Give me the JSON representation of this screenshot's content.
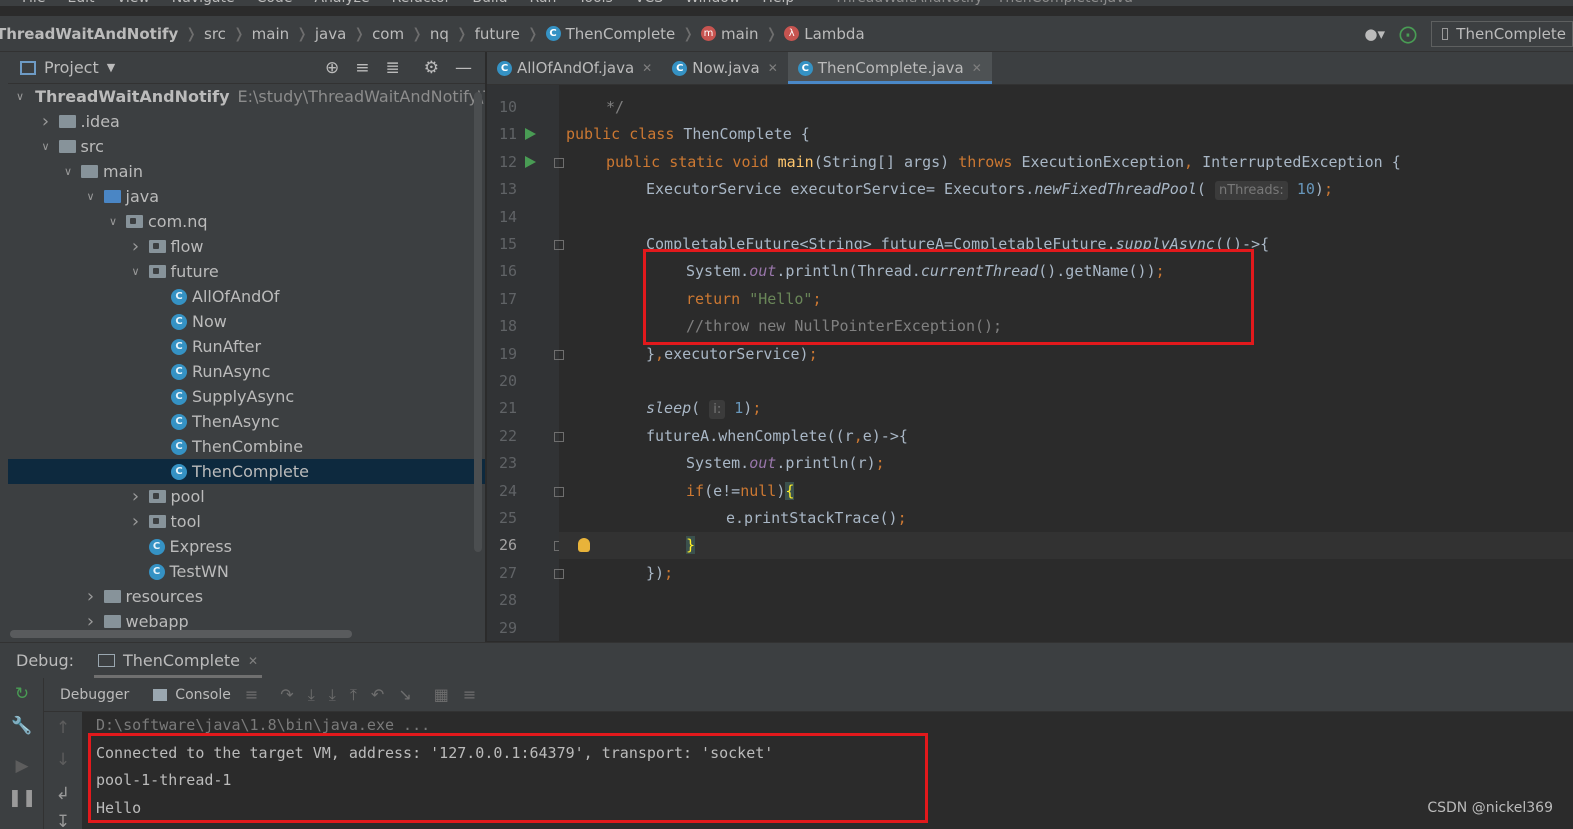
{
  "menu": {
    "items": [
      "File",
      "Edit",
      "View",
      "Navigate",
      "Code",
      "Analyze",
      "Refactor",
      "Build",
      "Run",
      "Tools",
      "VCS",
      "Window",
      "Help"
    ],
    "window_title": "ThreadWaitAndNotify - ThenComplete.java"
  },
  "breadcrumbs": [
    "ThreadWaitAndNotify",
    "src",
    "main",
    "java",
    "com",
    "nq",
    "future",
    "ThenComplete",
    "main",
    "Lambda"
  ],
  "nav_right": {
    "run_config": "ThenComplete"
  },
  "project_panel": {
    "title": "Project",
    "root": {
      "name": "ThreadWaitAndNotify",
      "path": "E:\\study\\ThreadWaitAndNotify\\Th"
    },
    "tree": [
      {
        "label": ".idea",
        "depth": 1,
        "expand": "collapsed",
        "kind": "folder"
      },
      {
        "label": "src",
        "depth": 1,
        "expand": "expanded",
        "kind": "folder"
      },
      {
        "label": "main",
        "depth": 2,
        "expand": "expanded",
        "kind": "folder"
      },
      {
        "label": "java",
        "depth": 3,
        "expand": "expanded",
        "kind": "folder-blue"
      },
      {
        "label": "com.nq",
        "depth": 4,
        "expand": "expanded",
        "kind": "package"
      },
      {
        "label": "flow",
        "depth": 5,
        "expand": "collapsed",
        "kind": "package"
      },
      {
        "label": "future",
        "depth": 5,
        "expand": "expanded",
        "kind": "package"
      },
      {
        "label": "AllOfAndOf",
        "depth": 6,
        "expand": "none",
        "kind": "class"
      },
      {
        "label": "Now",
        "depth": 6,
        "expand": "none",
        "kind": "class"
      },
      {
        "label": "RunAfter",
        "depth": 6,
        "expand": "none",
        "kind": "class"
      },
      {
        "label": "RunAsync",
        "depth": 6,
        "expand": "none",
        "kind": "class"
      },
      {
        "label": "SupplyAsync",
        "depth": 6,
        "expand": "none",
        "kind": "class"
      },
      {
        "label": "ThenAsync",
        "depth": 6,
        "expand": "none",
        "kind": "class"
      },
      {
        "label": "ThenCombine",
        "depth": 6,
        "expand": "none",
        "kind": "class"
      },
      {
        "label": "ThenComplete",
        "depth": 6,
        "expand": "none",
        "kind": "class",
        "selected": true
      },
      {
        "label": "pool",
        "depth": 5,
        "expand": "collapsed",
        "kind": "package"
      },
      {
        "label": "tool",
        "depth": 5,
        "expand": "collapsed",
        "kind": "package"
      },
      {
        "label": "Express",
        "depth": 5,
        "expand": "none",
        "kind": "class"
      },
      {
        "label": "TestWN",
        "depth": 5,
        "expand": "none",
        "kind": "class"
      },
      {
        "label": "resources",
        "depth": 3,
        "expand": "collapsed",
        "kind": "folder"
      },
      {
        "label": "webapp",
        "depth": 3,
        "expand": "collapsed",
        "kind": "folder"
      }
    ]
  },
  "editor_tabs": [
    {
      "label": "AllOfAndOf.java",
      "active": false
    },
    {
      "label": "Now.java",
      "active": false
    },
    {
      "label": "ThenComplete.java",
      "active": true
    }
  ],
  "editor": {
    "current_line": 26,
    "lines": [
      {
        "n": 10,
        "indent": 1,
        "parts": [
          [
            "cmt",
            "*/"
          ]
        ]
      },
      {
        "n": 11,
        "indent": 0,
        "run": true,
        "parts": [
          [
            "kw",
            "public class "
          ],
          [
            "",
            "ThenComplete {"
          ]
        ]
      },
      {
        "n": 12,
        "indent": 1,
        "run": true,
        "fold": true,
        "parts": [
          [
            "kw",
            "public static void "
          ],
          [
            "mth",
            "main"
          ],
          [
            "",
            "(String[] args) "
          ],
          [
            "kw",
            "throws "
          ],
          [
            "",
            "ExecutionException"
          ],
          [
            "kw",
            ", "
          ],
          [
            "",
            "InterruptedException {"
          ]
        ]
      },
      {
        "n": 13,
        "indent": 2,
        "parts": [
          [
            "",
            "ExecutorService executorService= Executors."
          ],
          [
            "it",
            "newFixedThreadPool"
          ],
          [
            "",
            "( "
          ],
          [
            "hint",
            "nThreads:"
          ],
          [
            "num",
            " 10"
          ],
          [
            "",
            ")"
          ],
          [
            "kw",
            ";"
          ]
        ]
      },
      {
        "n": 14,
        "indent": 0,
        "parts": []
      },
      {
        "n": 15,
        "indent": 2,
        "fold": true,
        "parts": [
          [
            "",
            "CompletableFuture<String> futureA=CompletableFuture."
          ],
          [
            "it",
            "supplyAsync"
          ],
          [
            "",
            "(()->{"
          ]
        ]
      },
      {
        "n": 16,
        "indent": 3,
        "parts": [
          [
            "",
            "System."
          ],
          [
            "fld",
            "out"
          ],
          [
            "",
            ".println(Thread."
          ],
          [
            "it",
            "currentThread"
          ],
          [
            "",
            "().getName())"
          ],
          [
            "kw",
            ";"
          ]
        ]
      },
      {
        "n": 17,
        "indent": 3,
        "parts": [
          [
            "kw",
            "return "
          ],
          [
            "str",
            "\"Hello\""
          ],
          [
            "kw",
            ";"
          ]
        ]
      },
      {
        "n": 18,
        "indent": 3,
        "parts": [
          [
            "cmt",
            "//throw new NullPointerException();"
          ]
        ]
      },
      {
        "n": 19,
        "indent": 2,
        "fold": true,
        "parts": [
          [
            "",
            "}"
          ],
          [
            "kw",
            ","
          ],
          [
            "",
            "executorService)"
          ],
          [
            "kw",
            ";"
          ]
        ]
      },
      {
        "n": 20,
        "indent": 0,
        "parts": []
      },
      {
        "n": 21,
        "indent": 2,
        "parts": [
          [
            "it",
            "sleep"
          ],
          [
            "",
            "( "
          ],
          [
            "hint",
            "i:"
          ],
          [
            "num",
            " 1"
          ],
          [
            "",
            ")"
          ],
          [
            "kw",
            ";"
          ]
        ]
      },
      {
        "n": 22,
        "indent": 2,
        "fold": true,
        "parts": [
          [
            "",
            "futureA.whenComplete((r"
          ],
          [
            "kw",
            ","
          ],
          [
            "",
            "e)->{"
          ]
        ]
      },
      {
        "n": 23,
        "indent": 3,
        "parts": [
          [
            "",
            "System."
          ],
          [
            "fld",
            "out"
          ],
          [
            "",
            ".println(r)"
          ],
          [
            "kw",
            ";"
          ]
        ]
      },
      {
        "n": 24,
        "indent": 3,
        "fold": true,
        "parts": [
          [
            "kw",
            "if"
          ],
          [
            "",
            "(e!="
          ],
          [
            "kw",
            "null"
          ],
          [
            "",
            ")"
          ],
          [
            "brace",
            "{"
          ]
        ]
      },
      {
        "n": 25,
        "indent": 4,
        "parts": [
          [
            "",
            "e.printStackTrace()"
          ],
          [
            "kw",
            ";"
          ]
        ]
      },
      {
        "n": 26,
        "indent": 3,
        "fold": true,
        "bulb": true,
        "parts": [
          [
            "brace",
            "}"
          ]
        ]
      },
      {
        "n": 27,
        "indent": 2,
        "fold": true,
        "parts": [
          [
            "",
            "})"
          ],
          [
            "kw",
            ";"
          ]
        ]
      },
      {
        "n": 28,
        "indent": 0,
        "parts": []
      },
      {
        "n": 29,
        "indent": 0,
        "parts": []
      }
    ]
  },
  "debug": {
    "label": "Debug:",
    "session_tab": "ThenComplete",
    "subtabs": [
      "Debugger",
      "Console"
    ],
    "console_lines": [
      {
        "text": "D:\\software\\java\\1.8\\bin\\java.exe ...",
        "dim": true
      },
      {
        "text": "Connected to the target VM, address: '127.0.0.1:64379', transport: 'socket'",
        "dim": false
      },
      {
        "text": "pool-1-thread-1",
        "dim": false
      },
      {
        "text": "Hello",
        "dim": false
      }
    ]
  },
  "watermark": "CSDN @nickel369",
  "colors": {
    "highlight_box": "#e2191c",
    "tab_underline": "#4a88c7",
    "selection": "#0d293e"
  }
}
